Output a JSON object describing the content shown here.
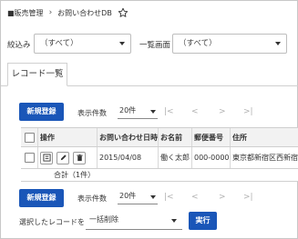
{
  "breadcrumb": {
    "root": "■販売管理",
    "separator": "›",
    "current": "お問い合わせDB",
    "favorite_icon": "star-icon"
  },
  "filters": {
    "narrow_label": "絞込み",
    "narrow_value": "（すべて）",
    "view_label": "一覧画面",
    "view_value": "（すべて）"
  },
  "tabs": [
    {
      "label": "レコード一覧",
      "active": true
    }
  ],
  "toolbar_top": {
    "new_button": "新規登録",
    "count_label": "表示件数",
    "count_value": "20件",
    "pager": {
      "first": "|<",
      "prev": "<",
      "next": ">",
      "last": ">|"
    }
  },
  "table": {
    "headers": [
      "",
      "操作",
      "お問い合わせ日時",
      "お名前",
      "郵便番号",
      "住所"
    ],
    "rows": [
      {
        "checked": false,
        "actions": [
          "detail-icon",
          "edit-icon",
          "delete-icon"
        ],
        "date": "2015/04/08",
        "name": "働く太郎",
        "zip": "000-0000",
        "address": "東京都新宿区西新宿"
      }
    ],
    "total": "合計（1件）"
  },
  "toolbar_bottom": {
    "new_button": "新規登録",
    "count_label": "表示件数",
    "count_value": "20件",
    "pager": {
      "first": "|<",
      "prev": "<",
      "next": ">",
      "last": ">|"
    }
  },
  "bulk": {
    "label": "選択したレコードを",
    "action_value": "一括削除",
    "run_button": "実行"
  },
  "colors": {
    "primary": "#1a56b8",
    "header_bg": "#f2f2f2",
    "border": "#cfcfcf",
    "disabled": "#b0b0b0"
  }
}
